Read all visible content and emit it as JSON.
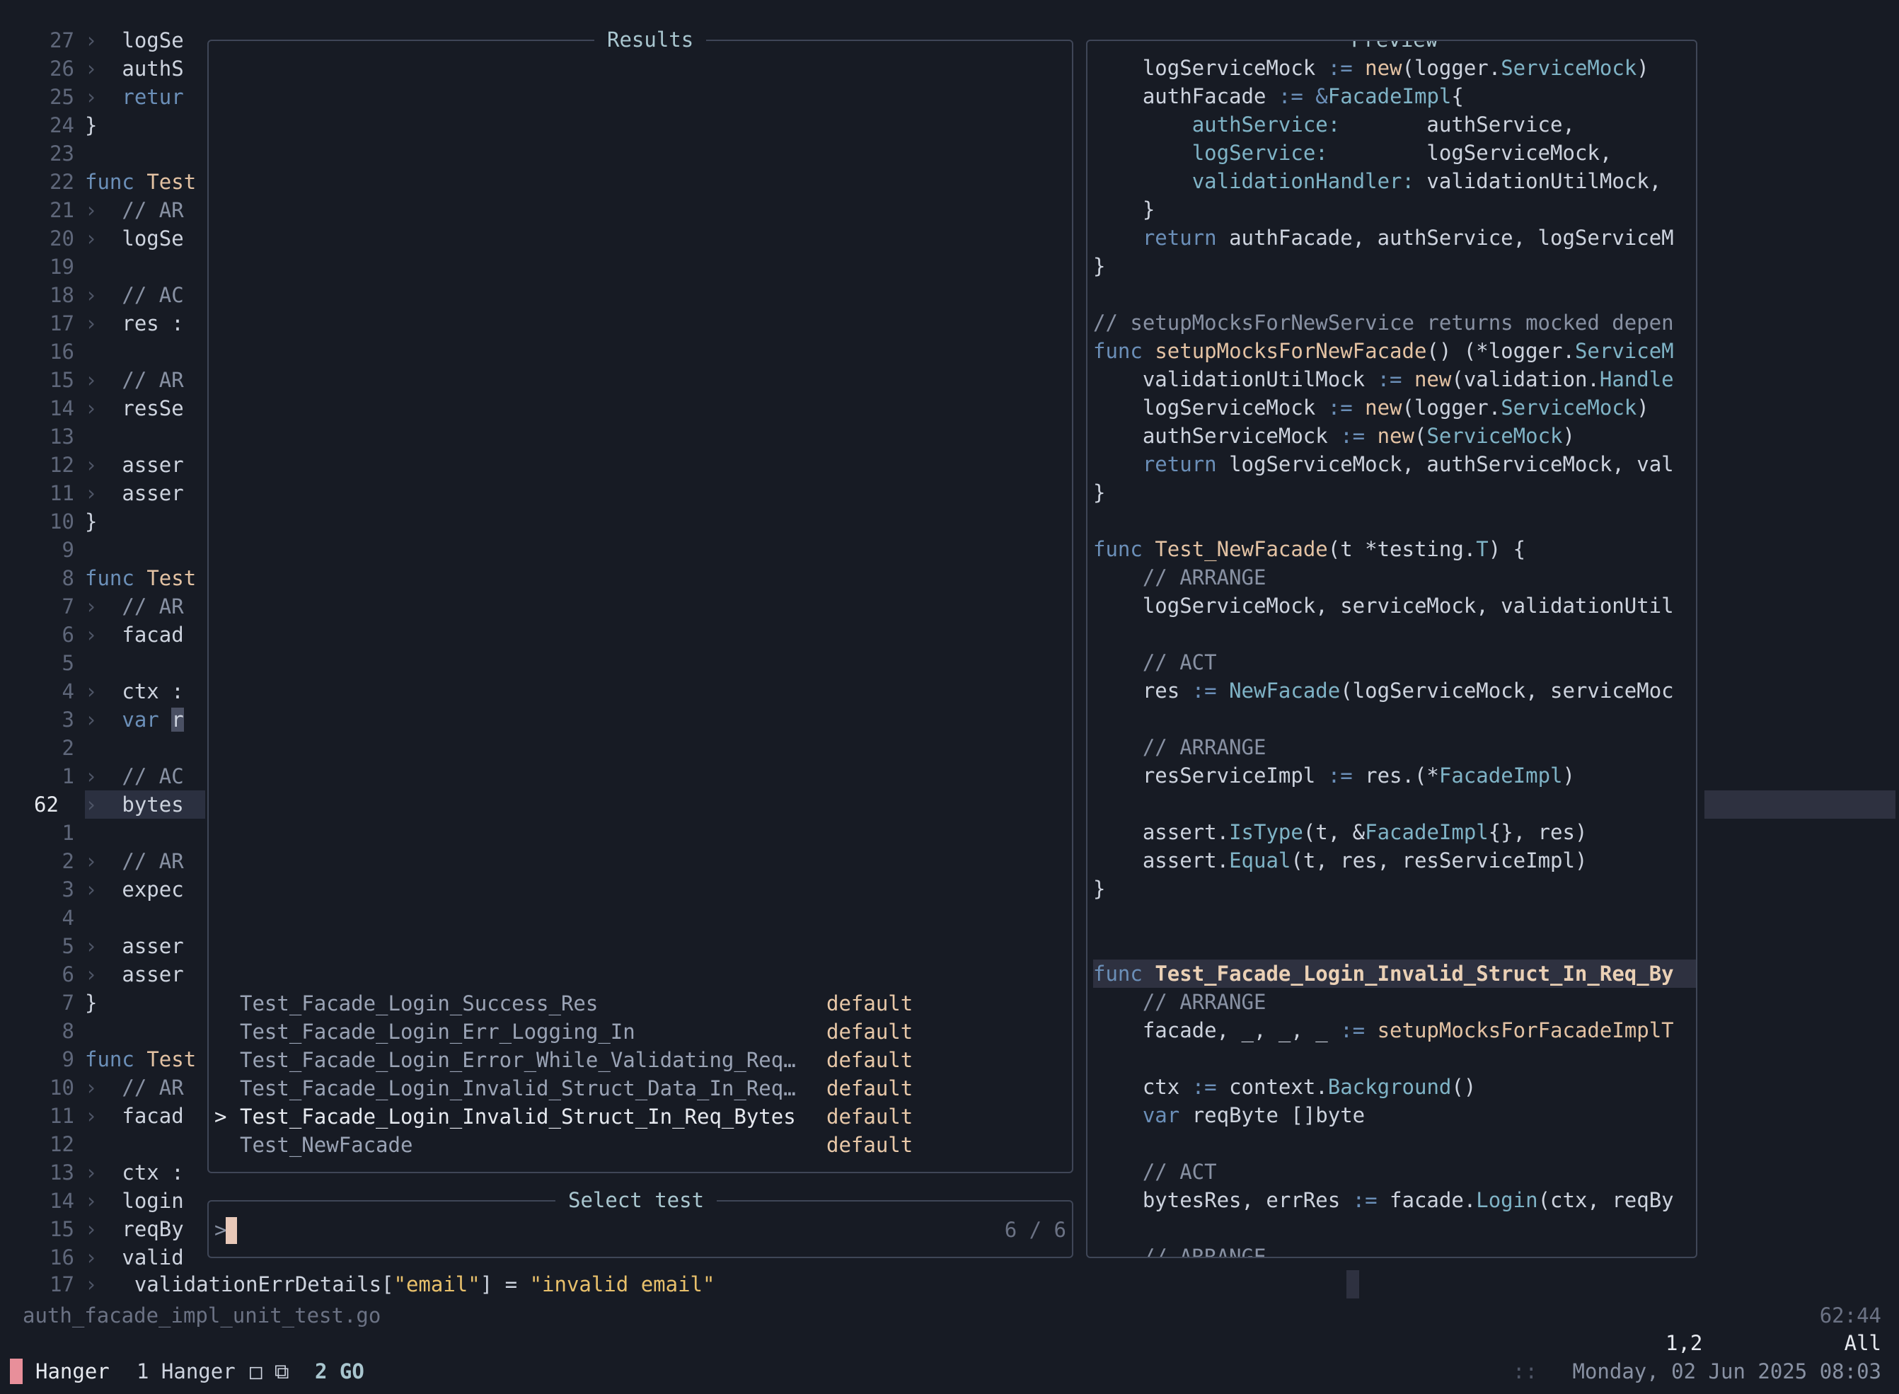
{
  "editor": {
    "line_numbers": [
      "27",
      "26",
      "25",
      "24",
      "23",
      "22",
      "21",
      "20",
      "19",
      "18",
      "17",
      "16",
      "15",
      "14",
      "13",
      "12",
      "11",
      "10",
      "9",
      "8",
      "7",
      "6",
      "5",
      "4",
      "3",
      "2",
      "1",
      "62",
      "1",
      "2",
      "3",
      "4",
      "5",
      "6",
      "7",
      "8",
      "9",
      "10",
      "11",
      "12",
      "13",
      "14",
      "15",
      "16"
    ],
    "current_line_index": 27,
    "last_line_number": "17",
    "last_line_text_parts": [
      "validationErrDetails[",
      "\"email\"",
      "] = ",
      "\"invalid email\""
    ],
    "code_lines": [
      {
        "g": "›",
        "t": "logSe",
        "c": ""
      },
      {
        "g": "›",
        "t": "authS",
        "c": ""
      },
      {
        "g": "›",
        "t": "retur",
        "c": "kw"
      },
      {
        "g": "",
        "t": "}",
        "c": ""
      },
      {
        "g": "",
        "t": "",
        "c": ""
      },
      {
        "g": "",
        "t": "func Test",
        "c": "func"
      },
      {
        "g": "›",
        "t": "// AR",
        "c": "cm"
      },
      {
        "g": "›",
        "t": "logSe",
        "c": ""
      },
      {
        "g": "",
        "t": "",
        "c": ""
      },
      {
        "g": "›",
        "t": "// AC",
        "c": "cm"
      },
      {
        "g": "›",
        "t": "res :",
        "c": ""
      },
      {
        "g": "",
        "t": "",
        "c": ""
      },
      {
        "g": "›",
        "t": "// AR",
        "c": "cm"
      },
      {
        "g": "›",
        "t": "resSe",
        "c": ""
      },
      {
        "g": "",
        "t": "",
        "c": ""
      },
      {
        "g": "›",
        "t": "asser",
        "c": ""
      },
      {
        "g": "›",
        "t": "asser",
        "c": ""
      },
      {
        "g": "",
        "t": "}",
        "c": ""
      },
      {
        "g": "",
        "t": "",
        "c": ""
      },
      {
        "g": "",
        "t": "func Test",
        "c": "func"
      },
      {
        "g": "›",
        "t": "// AR",
        "c": "cm"
      },
      {
        "g": "›",
        "t": "facad",
        "c": ""
      },
      {
        "g": "",
        "t": "",
        "c": ""
      },
      {
        "g": "›",
        "t": "ctx :",
        "c": ""
      },
      {
        "g": "›",
        "t": "var r",
        "c": "var"
      },
      {
        "g": "",
        "t": "",
        "c": ""
      },
      {
        "g": "›",
        "t": "// AC",
        "c": "cm"
      },
      {
        "g": "›",
        "t": "bytes",
        "c": ""
      },
      {
        "g": "",
        "t": "",
        "c": ""
      },
      {
        "g": "›",
        "t": "// AR",
        "c": "cm"
      },
      {
        "g": "›",
        "t": "expec",
        "c": ""
      },
      {
        "g": "",
        "t": "",
        "c": ""
      },
      {
        "g": "›",
        "t": "asser",
        "c": ""
      },
      {
        "g": "›",
        "t": "asser",
        "c": ""
      },
      {
        "g": "",
        "t": "}",
        "c": ""
      },
      {
        "g": "",
        "t": "",
        "c": ""
      },
      {
        "g": "",
        "t": "func Test",
        "c": "func"
      },
      {
        "g": "›",
        "t": "// AR",
        "c": "cm"
      },
      {
        "g": "›",
        "t": "facad",
        "c": ""
      },
      {
        "g": "",
        "t": "",
        "c": ""
      },
      {
        "g": "›",
        "t": "ctx :",
        "c": ""
      },
      {
        "g": "›",
        "t": "login",
        "c": ""
      },
      {
        "g": "›",
        "t": "reqBy",
        "c": ""
      },
      {
        "g": "›",
        "t": "valid",
        "c": ""
      }
    ]
  },
  "results": {
    "title": "Results",
    "items": [
      {
        "name": "Test_Facade_Login_Success_Res",
        "tag": "default",
        "selected": false
      },
      {
        "name": "Test_Facade_Login_Err_Logging_In",
        "tag": "default",
        "selected": false
      },
      {
        "name": "Test_Facade_Login_Error_While_Validating_Req…",
        "tag": "default",
        "selected": false
      },
      {
        "name": "Test_Facade_Login_Invalid_Struct_Data_In_Req…",
        "tag": "default",
        "selected": false
      },
      {
        "name": "Test_Facade_Login_Invalid_Struct_In_Req_Bytes",
        "tag": "default",
        "selected": true
      },
      {
        "name": "Test_NewFacade",
        "tag": "default",
        "selected": false
      }
    ],
    "selected_marker": ">"
  },
  "prompt": {
    "title": "Select test",
    "prefix": ">",
    "count": "6 / 6"
  },
  "preview": {
    "title": "Preview",
    "highlight_index": 32,
    "lines": [
      [
        [
          "    logServiceMock ",
          ""
        ],
        [
          ":= ",
          "op"
        ],
        [
          "new",
          "fn"
        ],
        [
          "(logger.",
          ""
        ],
        [
          "ServiceMock",
          "ty"
        ],
        [
          ")",
          ""
        ]
      ],
      [
        [
          "    authFacade ",
          ""
        ],
        [
          ":= ",
          "op"
        ],
        [
          "&",
          "op"
        ],
        [
          "FacadeImpl",
          "ty"
        ],
        [
          "{",
          ""
        ]
      ],
      [
        [
          "        ",
          ""
        ],
        [
          "authService:",
          "ty"
        ],
        [
          "       authService,",
          ""
        ]
      ],
      [
        [
          "        ",
          ""
        ],
        [
          "logService:",
          "ty"
        ],
        [
          "        logServiceMock,",
          ""
        ]
      ],
      [
        [
          "        ",
          ""
        ],
        [
          "validationHandler:",
          "ty"
        ],
        [
          " validationUtilMock,",
          ""
        ]
      ],
      [
        [
          "    }",
          ""
        ]
      ],
      [
        [
          "    ",
          ""
        ],
        [
          "return",
          "kw"
        ],
        [
          " authFacade, authService, logServiceM",
          ""
        ]
      ],
      [
        [
          "}",
          ""
        ]
      ],
      [
        [
          "",
          ""
        ]
      ],
      [
        [
          "// setupMocksForNewService returns mocked depen",
          "cm"
        ]
      ],
      [
        [
          "func",
          "kw"
        ],
        [
          " ",
          ""
        ],
        [
          "setupMocksForNewFacade",
          "fn"
        ],
        [
          "() (*logger.",
          ""
        ],
        [
          "ServiceM",
          "ty"
        ]
      ],
      [
        [
          "    validationUtilMock ",
          ""
        ],
        [
          ":= ",
          "op"
        ],
        [
          "new",
          "fn"
        ],
        [
          "(validation.",
          ""
        ],
        [
          "Handle",
          "ty"
        ]
      ],
      [
        [
          "    logServiceMock ",
          ""
        ],
        [
          ":= ",
          "op"
        ],
        [
          "new",
          "fn"
        ],
        [
          "(logger.",
          ""
        ],
        [
          "ServiceMock",
          "ty"
        ],
        [
          ")",
          ""
        ]
      ],
      [
        [
          "    authServiceMock ",
          ""
        ],
        [
          ":= ",
          "op"
        ],
        [
          "new",
          "fn"
        ],
        [
          "(",
          ""
        ],
        [
          "ServiceMock",
          "ty"
        ],
        [
          ")",
          ""
        ]
      ],
      [
        [
          "    ",
          ""
        ],
        [
          "return",
          "kw"
        ],
        [
          " logServiceMock, authServiceMock, val",
          ""
        ]
      ],
      [
        [
          "}",
          ""
        ]
      ],
      [
        [
          "",
          ""
        ]
      ],
      [
        [
          "func",
          "kw"
        ],
        [
          " ",
          ""
        ],
        [
          "Test_NewFacade",
          "fn"
        ],
        [
          "(t *testing.",
          ""
        ],
        [
          "T",
          "ty"
        ],
        [
          ") {",
          ""
        ]
      ],
      [
        [
          "    // ARRANGE",
          "cm"
        ]
      ],
      [
        [
          "    logServiceMock, serviceMock, validationUtil",
          ""
        ]
      ],
      [
        [
          "",
          ""
        ]
      ],
      [
        [
          "    // ACT",
          "cm"
        ]
      ],
      [
        [
          "    res ",
          ""
        ],
        [
          ":= ",
          "op"
        ],
        [
          "NewFacade",
          "ty"
        ],
        [
          "(logServiceMock, serviceMoc",
          ""
        ]
      ],
      [
        [
          "",
          ""
        ]
      ],
      [
        [
          "    // ARRANGE",
          "cm"
        ]
      ],
      [
        [
          "    resServiceImpl ",
          ""
        ],
        [
          ":= ",
          "op"
        ],
        [
          "res.(*",
          ""
        ],
        [
          "FacadeImpl",
          "ty"
        ],
        [
          ")",
          ""
        ]
      ],
      [
        [
          "",
          ""
        ]
      ],
      [
        [
          "    assert.",
          ""
        ],
        [
          "IsType",
          "ty"
        ],
        [
          "(t, &",
          ""
        ],
        [
          "FacadeImpl",
          "ty"
        ],
        [
          "{}, res)",
          ""
        ]
      ],
      [
        [
          "    assert.",
          ""
        ],
        [
          "Equal",
          "ty"
        ],
        [
          "(t, res, resServiceImpl)",
          ""
        ]
      ],
      [
        [
          "}",
          ""
        ]
      ],
      [
        [
          "",
          ""
        ]
      ],
      [
        [
          "",
          ""
        ]
      ],
      [
        [
          "func",
          "kw"
        ],
        [
          " ",
          ""
        ],
        [
          "Test_Facade_Login_Invalid_Struct_In_Req_By",
          "fn"
        ]
      ],
      [
        [
          "    // ARRANGE",
          "cm"
        ]
      ],
      [
        [
          "    facade, _, _, _ ",
          ""
        ],
        [
          ":= ",
          "op"
        ],
        [
          "setupMocksForFacadeImplT",
          "fn"
        ]
      ],
      [
        [
          "",
          ""
        ]
      ],
      [
        [
          "    ctx ",
          ""
        ],
        [
          ":= ",
          "op"
        ],
        [
          "context.",
          ""
        ],
        [
          "Background",
          "ty"
        ],
        [
          "()",
          ""
        ]
      ],
      [
        [
          "    ",
          ""
        ],
        [
          "var",
          "kw"
        ],
        [
          " reqByte []byte",
          ""
        ]
      ],
      [
        [
          "",
          ""
        ]
      ],
      [
        [
          "    // ACT",
          "cm"
        ]
      ],
      [
        [
          "    bytesRes, errRes ",
          ""
        ],
        [
          ":= ",
          "op"
        ],
        [
          "facade.",
          ""
        ],
        [
          "Login",
          "ty"
        ],
        [
          "(ctx, reqBy",
          ""
        ]
      ],
      [
        [
          "",
          ""
        ]
      ],
      [
        [
          "    // ARRANGE",
          "cm"
        ]
      ]
    ]
  },
  "status": {
    "filename": "auth_facade_impl_unit_test.go",
    "file_position": "62:44",
    "cursor_position": "1,2",
    "scroll_percent": "All"
  },
  "tmux": {
    "session": "Hanger",
    "window1": "1 Hanger",
    "window1_icons": "□ ⧉",
    "window2": "2 GO",
    "separator": "::",
    "datetime": "Monday, 02 Jun 2025 08:03"
  }
}
